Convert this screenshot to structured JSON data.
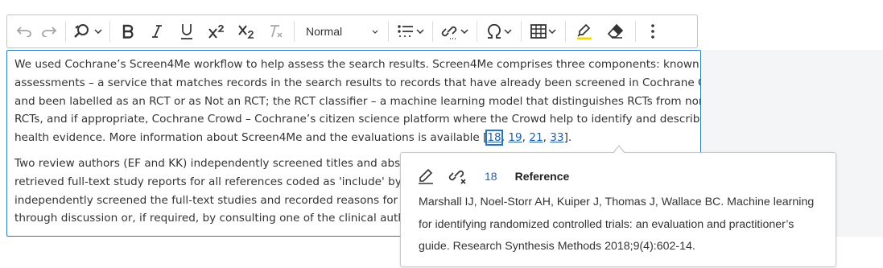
{
  "toolbar": {
    "undo_icon": "undo-icon",
    "redo_icon": "redo-icon",
    "find_icon": "find-replace-icon",
    "heading_value": "Normal",
    "colors": {
      "accent": "#2977c9",
      "link": "#1f5fb2",
      "icon": "#333333",
      "disabled": "#a4a4a4"
    }
  },
  "editor": {
    "p1_lines": [
      "We used Cochrane’s Screen4Me workflow to help assess the search results. Screen4Me comprises three components: known",
      "assessments – a service that matches records in the search results to records that have already been screened in Cochrane Crowd",
      "and been labelled as an RCT or as Not an RCT; the RCT classifier – a machine learning model that distinguishes RCTs from non-",
      "RCTs, and if appropriate, Cochrane Crowd – Cochrane’s citizen science platform where the Crowd help to identify and describe"
    ],
    "p1_last_line_prefix": "health evidence. More information about Screen4Me and the evaluations is available ",
    "citations": [
      "18",
      "19",
      "21",
      "33"
    ],
    "p2_lines": [
      "Two review authors (EF and KK) independently screened titles and abstra",
      "retrieved full-text study reports for all references coded as 'include' by eith",
      "independently screened the full-text studies and recorded reasons for exc",
      "through discussion or, if required, by consulting one of the clinical author"
    ]
  },
  "balloon": {
    "ref_number": "18",
    "title": "Reference",
    "text": "Marshall IJ, Noel-Storr AH, Kuiper J, Thomas J, Wallace BC. Machine learning for identifying randomized controlled trials: an evaluation and practitioner’s guide. Research Synthesis Methods 2018;9(4):602-14."
  }
}
